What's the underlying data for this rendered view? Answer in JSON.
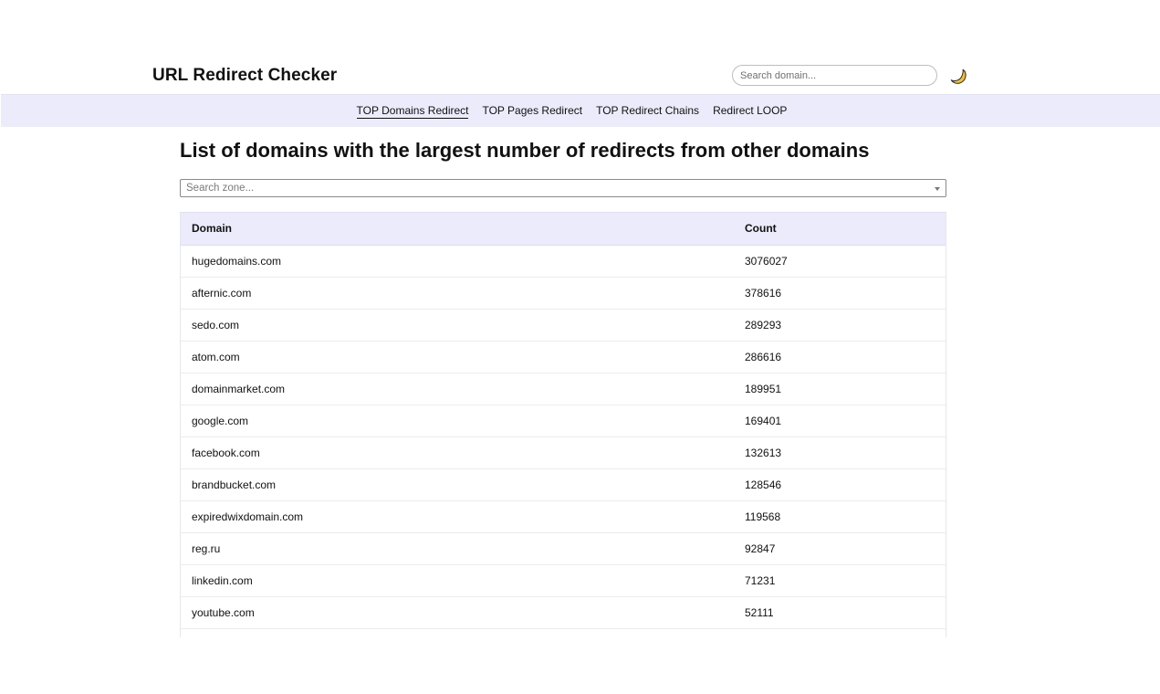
{
  "header": {
    "title": "URL Redirect Checker",
    "search_placeholder": "Search domain..."
  },
  "nav": {
    "items": [
      {
        "label": "TOP Domains Redirect"
      },
      {
        "label": "TOP Pages Redirect"
      },
      {
        "label": "TOP Redirect Chains"
      },
      {
        "label": "Redirect LOOP"
      }
    ]
  },
  "main": {
    "heading": "List of domains with the largest number of redirects from other domains",
    "zone_placeholder": "Search zone..."
  },
  "table": {
    "columns": [
      "Domain",
      "Count"
    ],
    "rows": [
      {
        "domain": "hugedomains.com",
        "count": "3076027"
      },
      {
        "domain": "afternic.com",
        "count": "378616"
      },
      {
        "domain": "sedo.com",
        "count": "289293"
      },
      {
        "domain": "atom.com",
        "count": "286616"
      },
      {
        "domain": "domainmarket.com",
        "count": "189951"
      },
      {
        "domain": "google.com",
        "count": "169401"
      },
      {
        "domain": "facebook.com",
        "count": "132613"
      },
      {
        "domain": "brandbucket.com",
        "count": "128546"
      },
      {
        "domain": "expiredwixdomain.com",
        "count": "119568"
      },
      {
        "domain": "reg.ru",
        "count": "92847"
      },
      {
        "domain": "linkedin.com",
        "count": "71231"
      },
      {
        "domain": "youtube.com",
        "count": "52111"
      }
    ]
  },
  "colors": {
    "nav_background": "#ecebfb",
    "moon": "#f2c230"
  },
  "icons": {
    "theme_toggle": "moon-icon",
    "select_caret": "chevron-down-icon"
  }
}
